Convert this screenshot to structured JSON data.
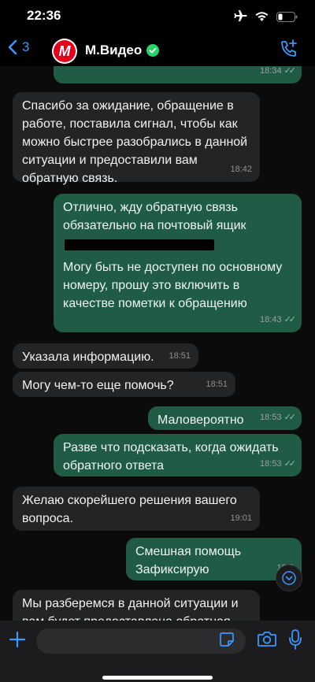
{
  "status_bar": {
    "time": "22:36"
  },
  "header": {
    "back_count": "3",
    "contact_name": "М.Видео",
    "avatar_letter": "М"
  },
  "messages": [
    {
      "dir": "out",
      "text": "",
      "time": "18:34"
    },
    {
      "dir": "in",
      "text": "Спасибо за ожидание, обращение в работе, поставила сигнал, чтобы как можно быстрее разобрались в данной ситуации и предоставили вам обратную связь.",
      "time": "18:42"
    },
    {
      "dir": "out",
      "text_part1": "Отлично, жду обратную связь обязательно на почтовый ящик",
      "text_part2": "Могу быть не доступен по основному номеру, прошу это включить в качестве пометки к обращению",
      "time": "18:43"
    },
    {
      "dir": "in",
      "text": "Указала информацию.",
      "time": "18:51"
    },
    {
      "dir": "in",
      "text": "Могу чем-то еще помочь?",
      "time": "18:51"
    },
    {
      "dir": "out",
      "text": "Маловероятно",
      "time": "18:53"
    },
    {
      "dir": "out",
      "text": "Разве что подсказать, когда ожидать обратного ответа",
      "time": "18:53"
    },
    {
      "dir": "in",
      "text": "Желаю скорейшего решения вашего вопроса.",
      "time": "19:01"
    },
    {
      "dir": "out",
      "text": "Смешная помощь\nЗафиксирую",
      "time": "19:0"
    },
    {
      "dir": "in",
      "text": "Мы разберемся в данной ситуации и вам будет предоставлена обратная",
      "time": ""
    }
  ],
  "composer": {
    "placeholder": ""
  },
  "colors": {
    "accent": "#3a97ff",
    "outgoing": "#1f5b45",
    "incoming": "#232426",
    "brand": "#e2001a",
    "verified": "#25d366"
  },
  "icons": [
    "airplane-icon",
    "wifi-icon",
    "battery-icon",
    "back-chevron-icon",
    "verified-icon",
    "add-call-icon",
    "plus-icon",
    "sticker-icon",
    "camera-icon",
    "microphone-icon",
    "chevron-down-icon",
    "read-ticks-icon"
  ]
}
